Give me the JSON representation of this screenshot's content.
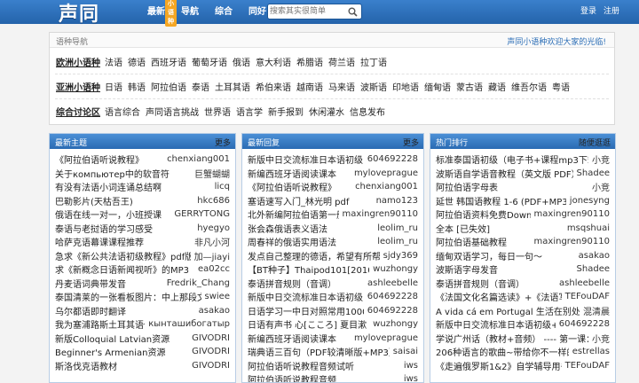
{
  "header": {
    "logo": "声同",
    "logo_badge": "小语种",
    "nav": [
      "最新",
      "导航",
      "综合",
      "同好"
    ],
    "search_placeholder": "搜索其实很简单",
    "login": "登录",
    "register": "注册"
  },
  "lang_nav": {
    "title": "语种导航",
    "welcome": "声同小语种欢迎大家的光临!",
    "rows": [
      {
        "category": "欧洲小语种",
        "items": [
          "法语",
          "德语",
          "西班牙语",
          "葡萄牙语",
          "俄语",
          "意大利语",
          "希腊语",
          "荷兰语",
          "拉丁语"
        ]
      },
      {
        "category": "亚洲小语种",
        "items": [
          "日语",
          "韩语",
          "阿拉伯语",
          "泰语",
          "土耳其语",
          "希伯来语",
          "越南语",
          "马来语",
          "波斯语",
          "印地语",
          "缅甸语",
          "蒙古语",
          "藏语",
          "维吾尔语",
          "粤语"
        ]
      },
      {
        "category": "综合讨论区",
        "items": [
          "语言综合",
          "声同语言挑战",
          "世界语",
          "语言学",
          "新手报到",
          "休闲灌水",
          "信息发布"
        ]
      }
    ]
  },
  "panels": [
    {
      "title": "最新主题",
      "more": "更多",
      "rows": [
        [
          "《阿拉伯语听说教程》",
          "chenxiang001"
        ],
        [
          "关于компьютер中的软音符",
          "巨蟹蝴蝴"
        ],
        [
          "有没有法语小词连诵总结啊",
          "licq"
        ],
        [
          "巴勒影片(天枯吾王)",
          "hkc686"
        ],
        [
          "俄语在线一对一，小班授课",
          "GERRYTONG"
        ],
        [
          "泰语与老挝语的学习感受",
          "hyegyo"
        ],
        [
          "哈萨克语幕课课程推荐",
          "非凡小河"
        ],
        [
          "急求《新公共法语初级教程》pdf版",
          "加—jiayi"
        ],
        [
          "求《新概念日语新闻视听》的MP3",
          "ea02cc"
        ],
        [
          "丹麦语词典带发音",
          "Fredrik_Chang"
        ],
        [
          "泰国清莱的一张看板图片：中上那段文",
          "swiee"
        ],
        [
          "乌尔都语即时翻译",
          "asakao"
        ],
        [
          "我为塞浦路斯土耳其语做的",
          "кынташибогатыр"
        ],
        [
          "新版Colloquial Latvian资源",
          "GIVODRI"
        ],
        [
          "Beginner's Armenian资源",
          "GIVODRI"
        ],
        [
          "斯洛伐克语教材",
          "GIVODRI"
        ]
      ]
    },
    {
      "title": "最新回复",
      "more": "更多",
      "rows": [
        [
          "新版中日交流标准日本语初级+中",
          "604692228"
        ],
        [
          "新编西班牙语阅读课本",
          "myloveprague"
        ],
        [
          "《阿拉伯语听说教程》",
          "chenxiang001"
        ],
        [
          "塞语速写入门_林光明 pdf",
          "namo123"
        ],
        [
          "北外新编阿拉伯语第一册词",
          "maxingren90110"
        ],
        [
          "张会森俄语表义语法",
          "leolim_ru"
        ],
        [
          "周春祥的俄语实用语法",
          "leolim_ru"
        ],
        [
          "发点自己整理的德语，希望有所帮助",
          "sjdy369"
        ],
        [
          "【BT种子】Thaipod101[2010-20",
          "wuzhongy"
        ],
        [
          "泰语拼音规则（音调）",
          "ashleebelle"
        ],
        [
          "新版中日交流标准日本语初级+中",
          "604692228"
        ],
        [
          "日语学习一中日对照常用1000句",
          "604692228"
        ],
        [
          "日语有声书 心[こころ] 夏目漱",
          "wuzhongy"
        ],
        [
          "新编西班牙语阅读课本",
          "myloveprague"
        ],
        [
          "瑞典语三百句（PDF较清晰版+MP3）",
          "saisai"
        ],
        [
          "阿拉伯语听说教程音频试听",
          "iws"
        ],
        [
          "阿拉伯语听说教程音频",
          "iws"
        ]
      ]
    },
    {
      "title": "热门排行",
      "more": "随便逛逛",
      "rows": [
        [
          "标准泰国语初级（电子书+课程mp3下载）",
          "小竞"
        ],
        [
          "波斯语自学语音教程（英文版 PDF）",
          "Shadee"
        ],
        [
          "阿拉伯语字母表",
          "小竞"
        ],
        [
          "延世 韩国语教程 1-6 (PDF+MP3)",
          "jonesyng"
        ],
        [
          "阿拉伯语资料免费Downlo",
          "maxingren90110"
        ],
        [
          "全本 [已失效]",
          "msqshuai"
        ],
        [
          "阿拉伯语基础教程",
          "maxingren90110"
        ],
        [
          "缅甸双语学习，每日一句～",
          "asakao"
        ],
        [
          "波斯语字母发音",
          "Shadee"
        ],
        [
          "泰语拼音规则（音调）",
          "ashleebelle"
        ],
        [
          "《法国文化名篇选读》+《法语写",
          "TEFouDAF"
        ],
        [
          "A vida cá em Portugal 生活在别处，",
          "混清晨"
        ],
        [
          "新版中日交流标准日本语初级+中",
          "604692228"
        ],
        [
          "学说广州话（教材+音频） ---- 第一课：",
          "小竞"
        ],
        [
          "206种语言的歌曲~带给你不一样的",
          "estrellas"
        ],
        [
          "《走遍俄罗斯1&2》自学辅导用书",
          "TEFouDAF"
        ]
      ]
    }
  ],
  "colors": {
    "header": "#2d6fb7",
    "panel_head": "#3a7cc3",
    "link_blue": "#2d6fb7"
  }
}
